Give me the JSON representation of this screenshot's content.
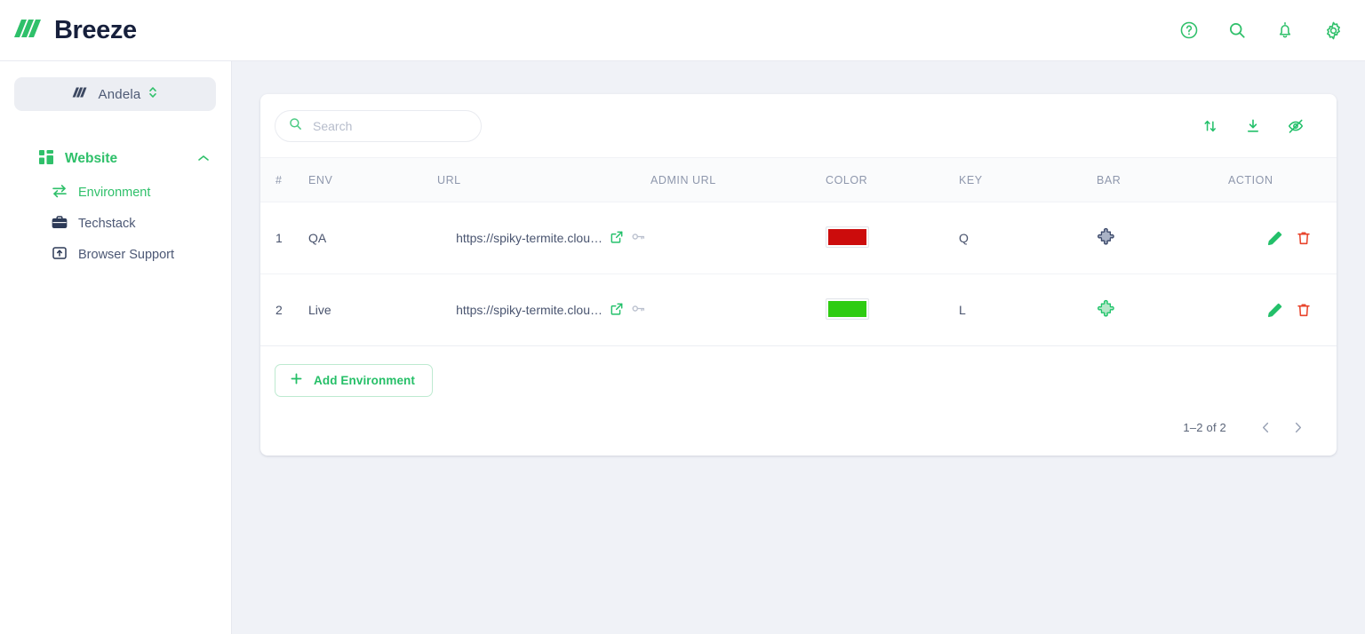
{
  "brand": {
    "name": "Breeze",
    "logo_icon": "breeze-slashes-logo",
    "accent": "#2fc06a",
    "text_color": "#17203c"
  },
  "topbar": {
    "icons": [
      {
        "name": "help-circle-icon",
        "glyph": "?"
      },
      {
        "name": "search-icon",
        "glyph": "search"
      },
      {
        "name": "notifications-bell-icon",
        "glyph": "bell"
      },
      {
        "name": "settings-gear-icon",
        "glyph": "gear"
      }
    ]
  },
  "sidebar": {
    "org": {
      "name": "Andela",
      "logo_icon": "andela-slashes-logo",
      "selector_icon": "chevron-up-down-icon"
    },
    "group": {
      "title": "Website",
      "icon": "dashboard-grid-icon",
      "expanded": true,
      "chevron": "chevron-up-icon"
    },
    "items": [
      {
        "label": "Environment",
        "icon": "transfer-arrows-icon",
        "active": true
      },
      {
        "label": "Techstack",
        "icon": "briefcase-icon",
        "active": false
      },
      {
        "label": "Browser Support",
        "icon": "browser-upload-icon",
        "active": false
      }
    ]
  },
  "card": {
    "search": {
      "placeholder": "Search",
      "value": "",
      "icon": "search-icon"
    },
    "toolbar_icons": [
      {
        "name": "sort-icon"
      },
      {
        "name": "download-icon"
      },
      {
        "name": "hide-columns-eye-off-icon"
      }
    ],
    "table": {
      "columns": [
        "#",
        "ENV",
        "URL",
        "ADMIN URL",
        "COLOR",
        "KEY",
        "BAR",
        "ACTION"
      ],
      "rows": [
        {
          "num": "1",
          "env": "QA",
          "url": "https://spiky-termite.clou…",
          "url_icons": [
            "external-link-icon",
            "key-icon"
          ],
          "admin_url": "",
          "color": "#cc0c0c",
          "key": "Q",
          "bar_icon": "puzzle-piece-icon",
          "bar_color": "#3d4a6b",
          "bar_fill": "#aab3c6",
          "actions": [
            "edit-pencil-icon",
            "delete-trash-icon"
          ]
        },
        {
          "num": "2",
          "env": "Live",
          "url": "https://spiky-termite.clou…",
          "url_icons": [
            "external-link-icon",
            "key-icon"
          ],
          "admin_url": "",
          "color": "#2ecc12",
          "key": "L",
          "bar_icon": "puzzle-piece-icon",
          "bar_color": "#1fc46a",
          "bar_fill": "#b6e7c9",
          "actions": [
            "edit-pencil-icon",
            "delete-trash-icon"
          ]
        }
      ]
    },
    "add_button": {
      "label": "Add Environment",
      "icon": "plus-icon"
    },
    "pagination": {
      "label": "1–2 of 2",
      "prev_icon": "chevron-left-icon",
      "next_icon": "chevron-right-icon"
    }
  }
}
